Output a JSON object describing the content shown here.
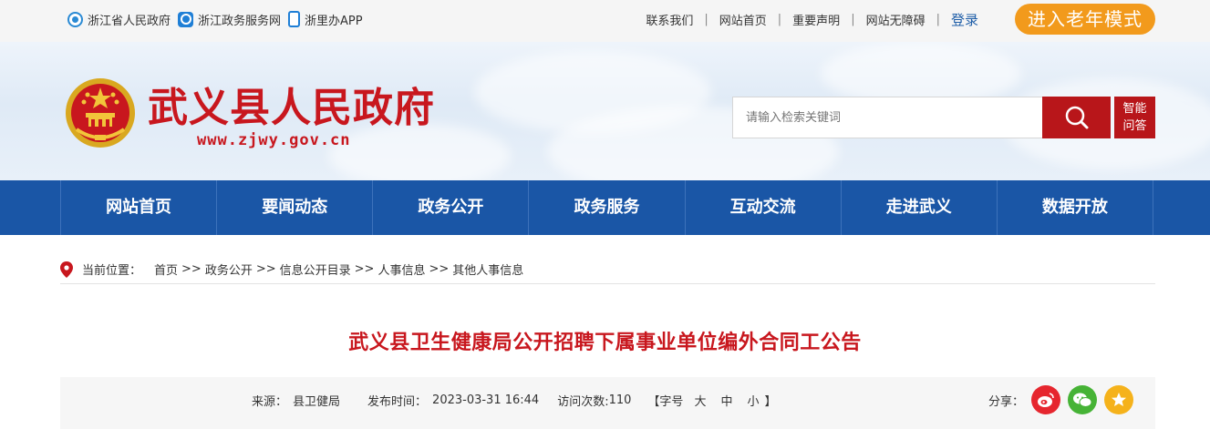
{
  "topbar": {
    "links_left": [
      {
        "label": "浙江省人民政府",
        "icon": "zhejiang-gov-icon"
      },
      {
        "label": "浙江政务服务网",
        "icon": "service-net-icon"
      },
      {
        "label": "浙里办APP",
        "icon": "phone-app-icon"
      }
    ],
    "links_right": [
      "联系我们",
      "网站首页",
      "重要声明",
      "网站无障碍"
    ],
    "separator": "|",
    "login": "登录",
    "elder_mode": "进入老年模式"
  },
  "header": {
    "site_title": "武义县人民政府",
    "site_url": "www.zjwy.gov.cn",
    "search_placeholder": "请输入检索关键词",
    "ai_line1": "智能",
    "ai_line2": "问答"
  },
  "nav": [
    "网站首页",
    "要闻动态",
    "政务公开",
    "政务服务",
    "互动交流",
    "走进武义",
    "数据开放"
  ],
  "breadcrumb": {
    "label": "当前位置：",
    "items": [
      "首页",
      "政务公开",
      "信息公开目录",
      "人事信息",
      "其他人事信息"
    ],
    "separator": ">>"
  },
  "article": {
    "title": "武义县卫生健康局公开招聘下属事业单位编外合同工公告",
    "source_label": "来源：",
    "source": "县卫健局",
    "date_label": "发布时间：",
    "date": "2023-03-31 16:44",
    "visits_label": "访问次数:",
    "visits": "110",
    "font_open": "【字号",
    "font_large": "大",
    "font_medium": "中",
    "font_small": "小",
    "font_close": "】",
    "share_label": "分享："
  },
  "colors": {
    "brand_red": "#c8171e",
    "nav_blue": "#1a56a6",
    "elder_orange": "#f29a1c"
  }
}
